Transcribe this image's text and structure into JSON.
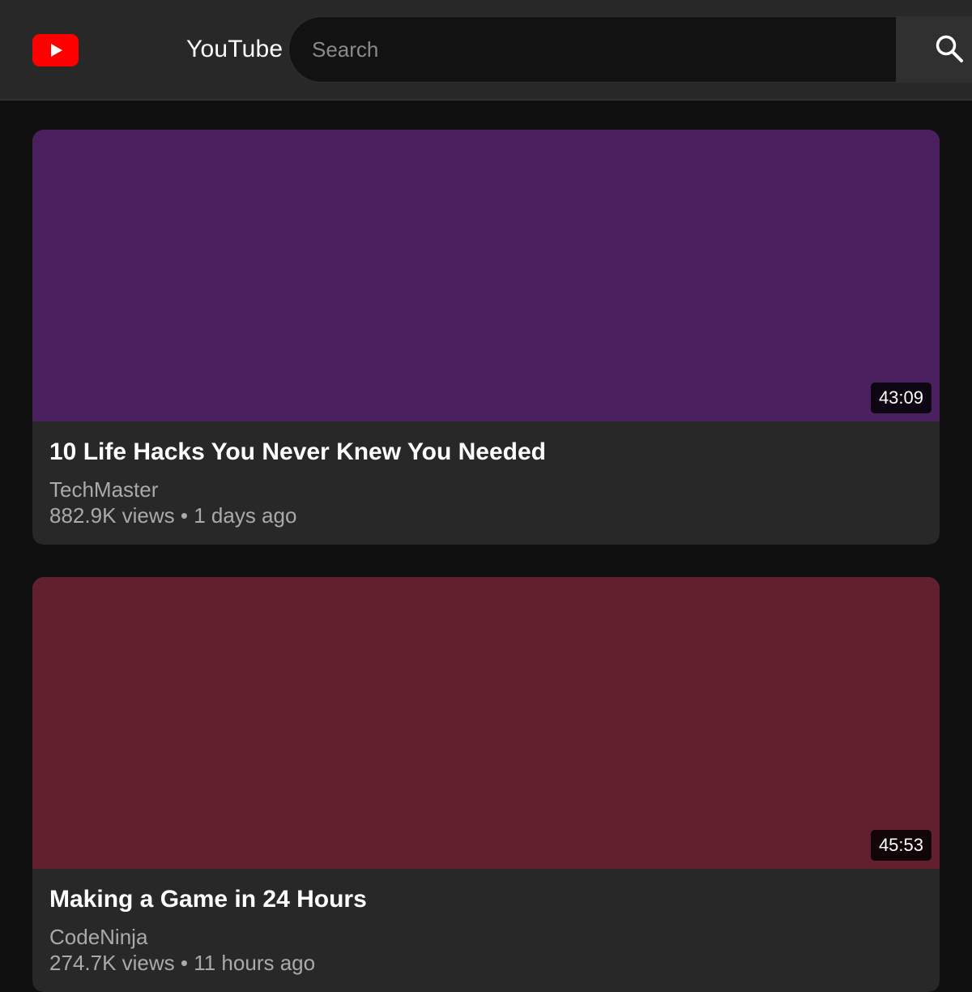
{
  "header": {
    "logo_icon": "youtube-play-icon",
    "logo_text": "YouTube",
    "search_placeholder": "Search",
    "search_icon": "search-icon"
  },
  "colors": {
    "brand_red": "#ff0000",
    "header_bg": "#282828",
    "page_bg": "#0f0f0f",
    "card_bg": "#282828"
  },
  "videos": [
    {
      "title": "10 Life Hacks You Never Knew You Needed",
      "channel": "TechMaster",
      "views": "882.9K views",
      "age": "1 days ago",
      "duration": "43:09",
      "thumbnail_color": "#4a205e"
    },
    {
      "title": "Making a Game in 24 Hours",
      "channel": "CodeNinja",
      "views": "274.7K views",
      "age": "11 hours ago",
      "duration": "45:53",
      "thumbnail_color": "#62202e"
    }
  ]
}
